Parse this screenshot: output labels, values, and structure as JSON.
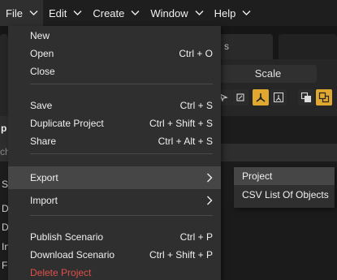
{
  "menubar": {
    "items": [
      {
        "label": "File"
      },
      {
        "label": "Edit"
      },
      {
        "label": "Create"
      },
      {
        "label": "Window"
      },
      {
        "label": "Help"
      }
    ]
  },
  "background": {
    "tab_partial_text": "s",
    "scale_label": "Scale",
    "panel_tab_partial": "p",
    "strip_partial": "ch",
    "left_rows": [
      "S",
      "D",
      "D",
      "In",
      "F"
    ]
  },
  "file_menu": {
    "items": [
      {
        "label": "New",
        "shortcut": ""
      },
      {
        "label": "Open",
        "shortcut": "Ctrl + O"
      },
      {
        "label": "Close",
        "shortcut": ""
      },
      {
        "label": "Save",
        "shortcut": "Ctrl + S"
      },
      {
        "label": "Duplicate Project",
        "shortcut": "Ctrl + Shift + S"
      },
      {
        "label": "Share",
        "shortcut": "Ctrl + Alt + S"
      },
      {
        "label": "Export",
        "shortcut": ""
      },
      {
        "label": "Import",
        "shortcut": ""
      },
      {
        "label": "Publish Scenario",
        "shortcut": "Ctrl + P"
      },
      {
        "label": "Download Scenario",
        "shortcut": "Ctrl + Shift + P"
      },
      {
        "label": "Delete Project",
        "shortcut": ""
      }
    ]
  },
  "export_submenu": {
    "items": [
      {
        "label": "Project"
      },
      {
        "label": "CSV List Of Objects"
      }
    ]
  },
  "colors": {
    "accent": "#e0a82e",
    "danger": "#e0504a",
    "menu_bg": "#2f2f2f",
    "highlight": "#464646"
  },
  "icons": [
    "chevron-down-icon",
    "chevron-right-icon",
    "move-tool-icon",
    "anchor-tool-icon",
    "layer-front-icon",
    "layer-back-icon"
  ]
}
